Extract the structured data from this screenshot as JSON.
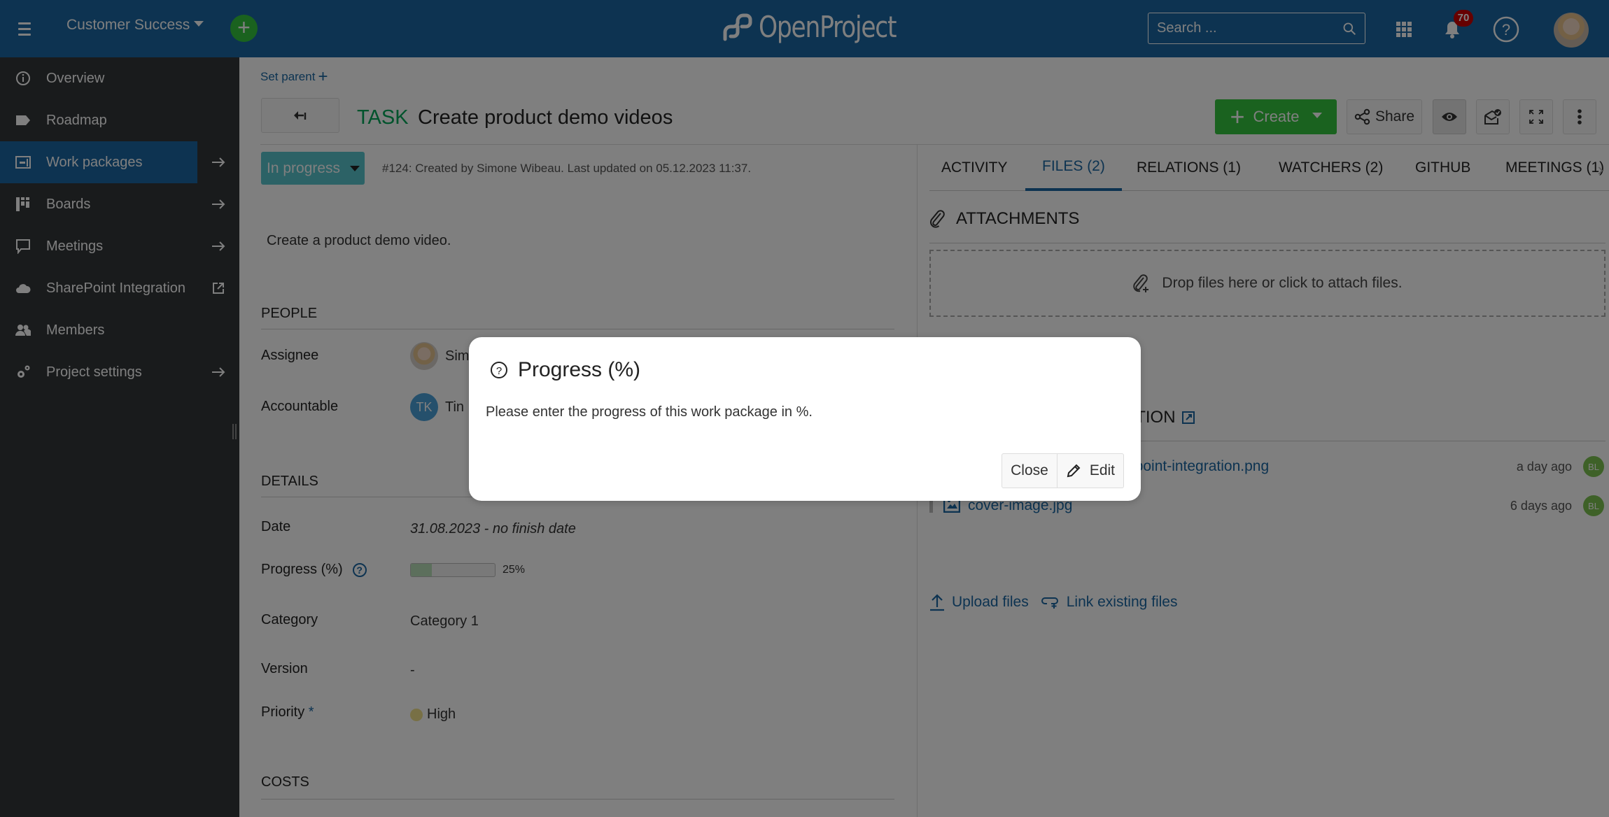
{
  "header": {
    "project_name": "Customer Success",
    "logo_text": "OpenProject",
    "search_placeholder": "Search ...",
    "notification_count": "70",
    "icons": [
      "menu-icon",
      "plus-icon",
      "search-icon",
      "grid-icon",
      "bell-icon",
      "help-icon",
      "user-avatar"
    ]
  },
  "sidebar": {
    "items": [
      {
        "label": "Overview",
        "icon": "info-icon",
        "trailing": ""
      },
      {
        "label": "Roadmap",
        "icon": "tag-icon",
        "trailing": ""
      },
      {
        "label": "Work packages",
        "icon": "work-packages-icon",
        "trailing": "arrow-right",
        "active": true
      },
      {
        "label": "Boards",
        "icon": "boards-icon",
        "trailing": "arrow-right"
      },
      {
        "label": "Meetings",
        "icon": "meetings-icon",
        "trailing": "arrow-right"
      },
      {
        "label": "SharePoint Integration",
        "icon": "cloud-icon",
        "trailing": "external-link"
      },
      {
        "label": "Members",
        "icon": "members-icon",
        "trailing": ""
      },
      {
        "label": "Project settings",
        "icon": "settings-icon",
        "trailing": "arrow-right"
      }
    ]
  },
  "work_package": {
    "set_parent_label": "Set parent",
    "type": "TASK",
    "subject": "Create product demo videos",
    "status": "In progress",
    "meta": "#124: Created by Simone Wibeau. Last updated on 05.12.2023 11:37.",
    "description": "Create a product demo video.",
    "toolbar": {
      "create_label": "Create",
      "share_label": "Share"
    },
    "sections": {
      "people": "PEOPLE",
      "details": "DETAILS",
      "costs": "COSTS"
    },
    "people": {
      "assignee_label": "Assignee",
      "assignee_value_visible": "Sim",
      "accountable_label": "Accountable",
      "accountable_initials": "TK",
      "accountable_value_visible": "Tin"
    },
    "details": {
      "date_label": "Date",
      "date_value": "31.08.2023 - no finish date",
      "progress_label": "Progress (%)",
      "progress_percent": 25,
      "progress_text": "25%",
      "category_label": "Category",
      "category_value": "Category 1",
      "version_label": "Version",
      "version_value": "-",
      "priority_label": "Priority",
      "priority_required": "*",
      "priority_value": "High",
      "priority_color": "#f1e08a"
    }
  },
  "right_panel": {
    "tabs": [
      {
        "label": "ACTIVITY",
        "active": false
      },
      {
        "label": "FILES (2)",
        "active": true
      },
      {
        "label": "RELATIONS (1)",
        "active": false
      },
      {
        "label": "WATCHERS (2)",
        "active": false
      },
      {
        "label": "GITHUB",
        "active": false
      },
      {
        "label": "MEETINGS (1)",
        "active": false
      }
    ],
    "attachments_title": "ATTACHMENTS",
    "dropzone_text": "Drop files here or click to attach files.",
    "storage_heading_visible": "ATION",
    "files": [
      {
        "name_visible": "repoint-integration.png",
        "time": "a day ago",
        "author_initials": "BL"
      },
      {
        "name_visible": "cover-image.jpg",
        "time": "6 days ago",
        "author_initials": "BL"
      }
    ],
    "upload_label": "Upload files",
    "link_label": "Link existing files"
  },
  "modal": {
    "title": "Progress (%)",
    "text": "Please enter the progress of this work package in %.",
    "close_label": "Close",
    "edit_label": "Edit"
  },
  "colors": {
    "header_bg": "#1a67a3",
    "sidebar_bg": "#333739",
    "accent_green": "#35c53f",
    "type_green": "#00a758",
    "status_teal": "#59c4cc",
    "link_blue": "#1a67a3"
  }
}
